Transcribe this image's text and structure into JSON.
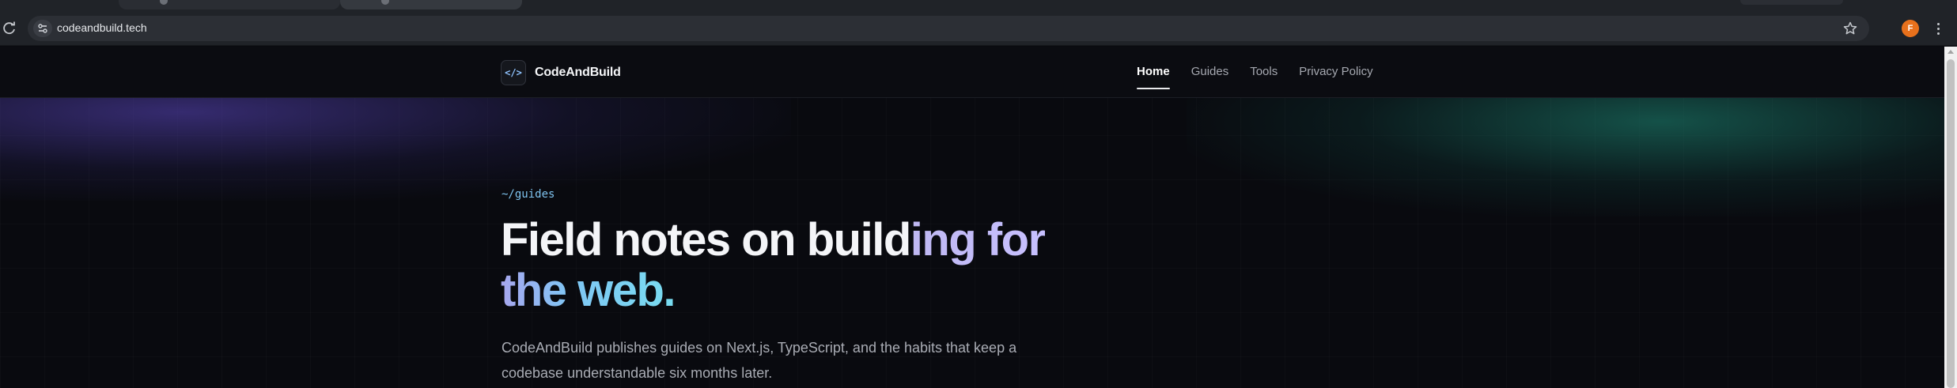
{
  "browser": {
    "url": "codeandbuild.tech",
    "profile_initial": "F"
  },
  "site": {
    "brand_logo": "</>",
    "brand_name": "CodeAndBuild",
    "nav": [
      {
        "label": "Home",
        "active": true
      },
      {
        "label": "Guides",
        "active": false
      },
      {
        "label": "Tools",
        "active": false
      },
      {
        "label": "Privacy Policy",
        "active": false
      }
    ]
  },
  "hero": {
    "kicker": "~/guides",
    "headline_part1": "Field notes on build",
    "headline_part2": "ing for",
    "headline_line2": "the web.",
    "intro": "CodeAndBuild publishes guides on Next.js, TypeScript, and the habits that keep a codebase understandable six months later."
  },
  "icons": {
    "reload": "reload-icon",
    "site_info": "site-info-icon",
    "bookmark": "star-icon",
    "menu": "kebab-menu-icon"
  }
}
